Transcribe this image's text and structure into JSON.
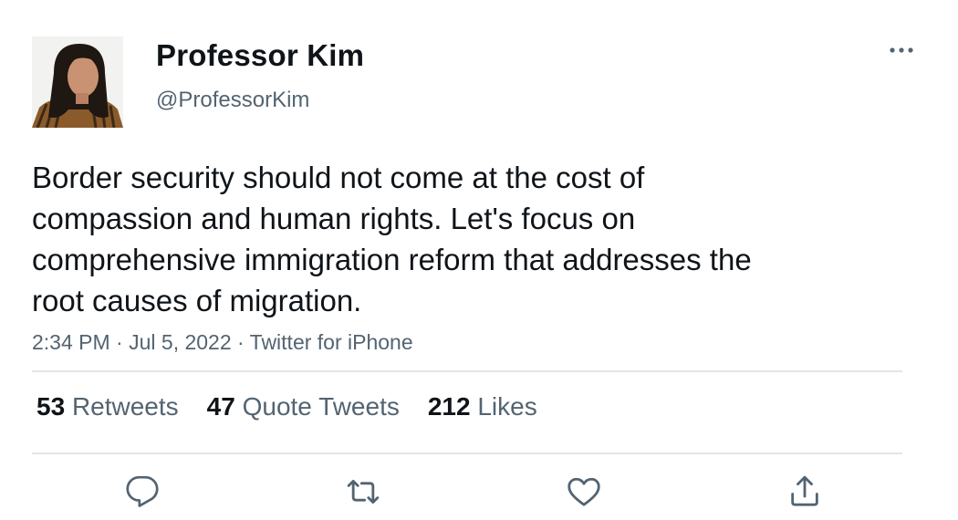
{
  "author": {
    "display_name": "Professor Kim",
    "handle": "@ProfessorKim"
  },
  "tweet": {
    "text_lines": [
      "Border security should not come at the cost of",
      "compassion and human rights. Let's focus on",
      "comprehensive immigration reform that addresses the",
      "root causes of migration."
    ],
    "time": "2:34 PM",
    "date": "Jul 5, 2022",
    "source": "Twitter for iPhone",
    "separator": " · "
  },
  "stats": {
    "retweets": {
      "count": "53",
      "label": "Retweets"
    },
    "quote_tweets": {
      "count": "47",
      "label": "Quote Tweets"
    },
    "likes": {
      "count": "212",
      "label": "Likes"
    }
  },
  "icons": {
    "more": "more-icon",
    "reply": "reply-icon",
    "retweet": "retweet-icon",
    "like": "like-icon",
    "share": "share-icon"
  },
  "colors": {
    "primary_text": "#0f1419",
    "secondary_text": "#536471",
    "icon": "#536471",
    "divider": "#e1e5e8"
  }
}
